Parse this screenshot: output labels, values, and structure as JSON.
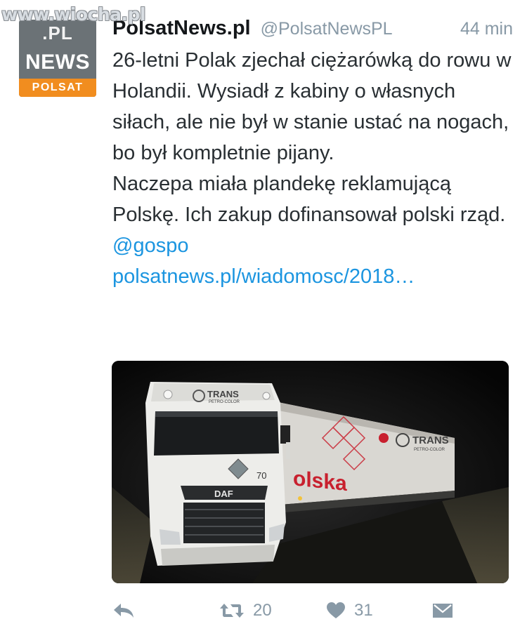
{
  "watermark": {
    "text": "www.wiocha.pl"
  },
  "avatar": {
    "top_text": ".PL",
    "middle_text": "NEWS",
    "bottom_text": "POLSAT"
  },
  "tweet": {
    "display_name": "PolsatNews.pl",
    "handle": "@PolsatNewsPL",
    "time": "44 min",
    "paragraph1": "26-letni Polak zjechał ciężarówką do rowu w Holandii. Wysiadł z kabiny o własnych siłach, ale nie był w stanie ustać na nogach, bo był kompletnie pijany.",
    "paragraph2": "Naczepa miała plandekę reklamującą Polskę. Ich zakup dofinansował polski rząd.",
    "mention": "@gospo",
    "url": "polsatnews.pl/wiadomosc/2018…"
  },
  "media": {
    "cab_brand": "TRANS",
    "cab_subtext": "PETRO-COLOR",
    "truck_number": "70",
    "truck_make": "DAF",
    "trailer_text": "olska",
    "trailer_brand": "TRANS",
    "trailer_subtext": "PETRO-COLOR"
  },
  "actions": {
    "reply_icon": "reply-icon",
    "retweet_icon": "retweet-icon",
    "retweet_count": "20",
    "like_icon": "heart-icon",
    "like_count": "31",
    "dm_icon": "envelope-icon"
  },
  "colors": {
    "link": "#1b95e0",
    "meta_gray": "#8899a6",
    "polsat_orange": "#f18d1f"
  }
}
